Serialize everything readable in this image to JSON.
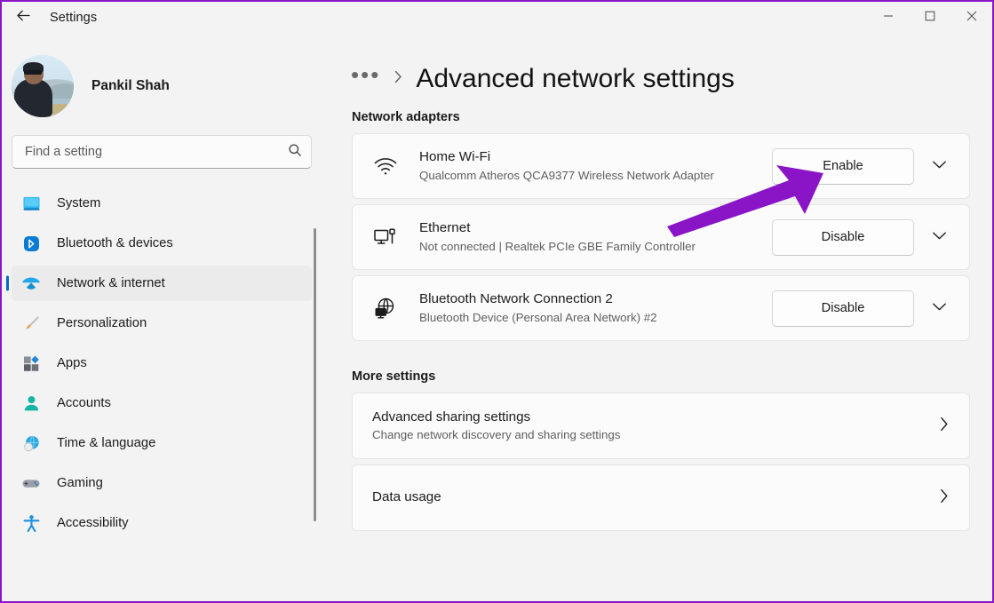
{
  "window": {
    "title": "Settings",
    "back_icon": "back-arrow-icon",
    "controls": {
      "minimize": "minimize-icon",
      "maximize": "maximize-icon",
      "close": "close-icon"
    },
    "annotation_color": "#8a15c6",
    "accent_color": "#0a64c8"
  },
  "sidebar": {
    "profile": {
      "name": "Pankil Shah",
      "avatar": "user-avatar"
    },
    "search": {
      "placeholder": "Find a setting",
      "value": "",
      "icon": "search-icon"
    },
    "items": [
      {
        "label": "System",
        "icon": "system-icon",
        "active": false
      },
      {
        "label": "Bluetooth & devices",
        "icon": "bluetooth-icon",
        "active": false
      },
      {
        "label": "Network & internet",
        "icon": "network-wifi-icon",
        "active": true
      },
      {
        "label": "Personalization",
        "icon": "paintbrush-icon",
        "active": false
      },
      {
        "label": "Apps",
        "icon": "apps-icon",
        "active": false
      },
      {
        "label": "Accounts",
        "icon": "accounts-icon",
        "active": false
      },
      {
        "label": "Time & language",
        "icon": "clock-globe-icon",
        "active": false
      },
      {
        "label": "Gaming",
        "icon": "gamepad-icon",
        "active": false
      },
      {
        "label": "Accessibility",
        "icon": "accessibility-icon",
        "active": false
      }
    ]
  },
  "main": {
    "breadcrumb": {
      "overflow": "•••",
      "separator": "›",
      "current": "Advanced network settings"
    },
    "sections": {
      "adapters_label": "Network adapters",
      "more_label": "More settings"
    },
    "adapters": [
      {
        "name": "Home Wi-Fi",
        "description": "Qualcomm Atheros QCA9377 Wireless Network Adapter",
        "action_label": "Enable",
        "icon": "wifi-icon",
        "expand_icon": "chevron-down-icon"
      },
      {
        "name": "Ethernet",
        "description": "Not connected | Realtek PCIe GBE Family Controller",
        "action_label": "Disable",
        "icon": "ethernet-icon",
        "expand_icon": "chevron-down-icon"
      },
      {
        "name": "Bluetooth Network Connection 2",
        "description": "Bluetooth Device (Personal Area Network) #2",
        "action_label": "Disable",
        "icon": "globe-network-icon",
        "expand_icon": "chevron-down-icon"
      }
    ],
    "more_settings": [
      {
        "title": "Advanced sharing settings",
        "subtitle": "Change network discovery and sharing settings",
        "chevron": "chevron-right-icon"
      },
      {
        "title": "Data usage",
        "subtitle": "",
        "chevron": "chevron-right-icon"
      }
    ]
  }
}
